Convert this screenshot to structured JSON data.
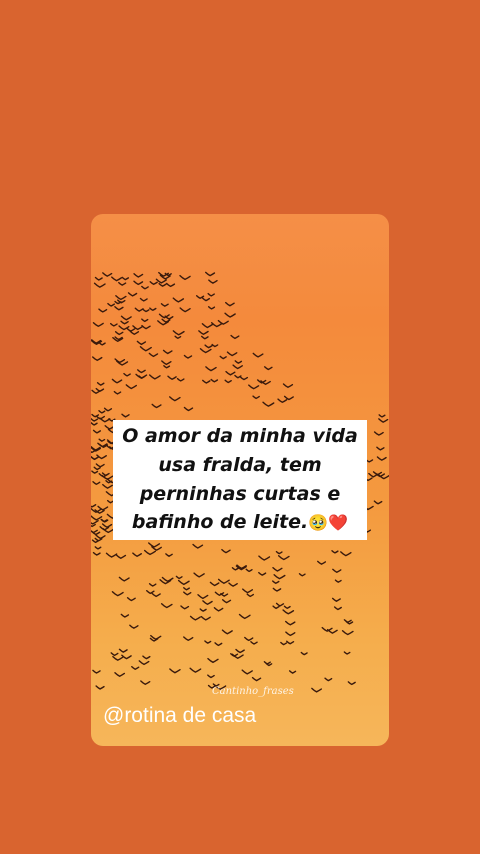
{
  "background_color": "#d9642f",
  "card": {
    "gradient_colors": [
      "#f58f47",
      "#f48a3c",
      "#f49a3f",
      "#f5ad4c",
      "#f6b65a"
    ],
    "quote_lines": [
      "O amor da minha vida",
      "usa fralda, tem",
      "perninhas curtas e",
      "bafinho de leite."
    ],
    "quote_emojis": "🥹❤️",
    "watermark": "Cantinho_frases",
    "handle": "@rotina de casa"
  },
  "icons": [
    "flock-of-birds-image"
  ]
}
